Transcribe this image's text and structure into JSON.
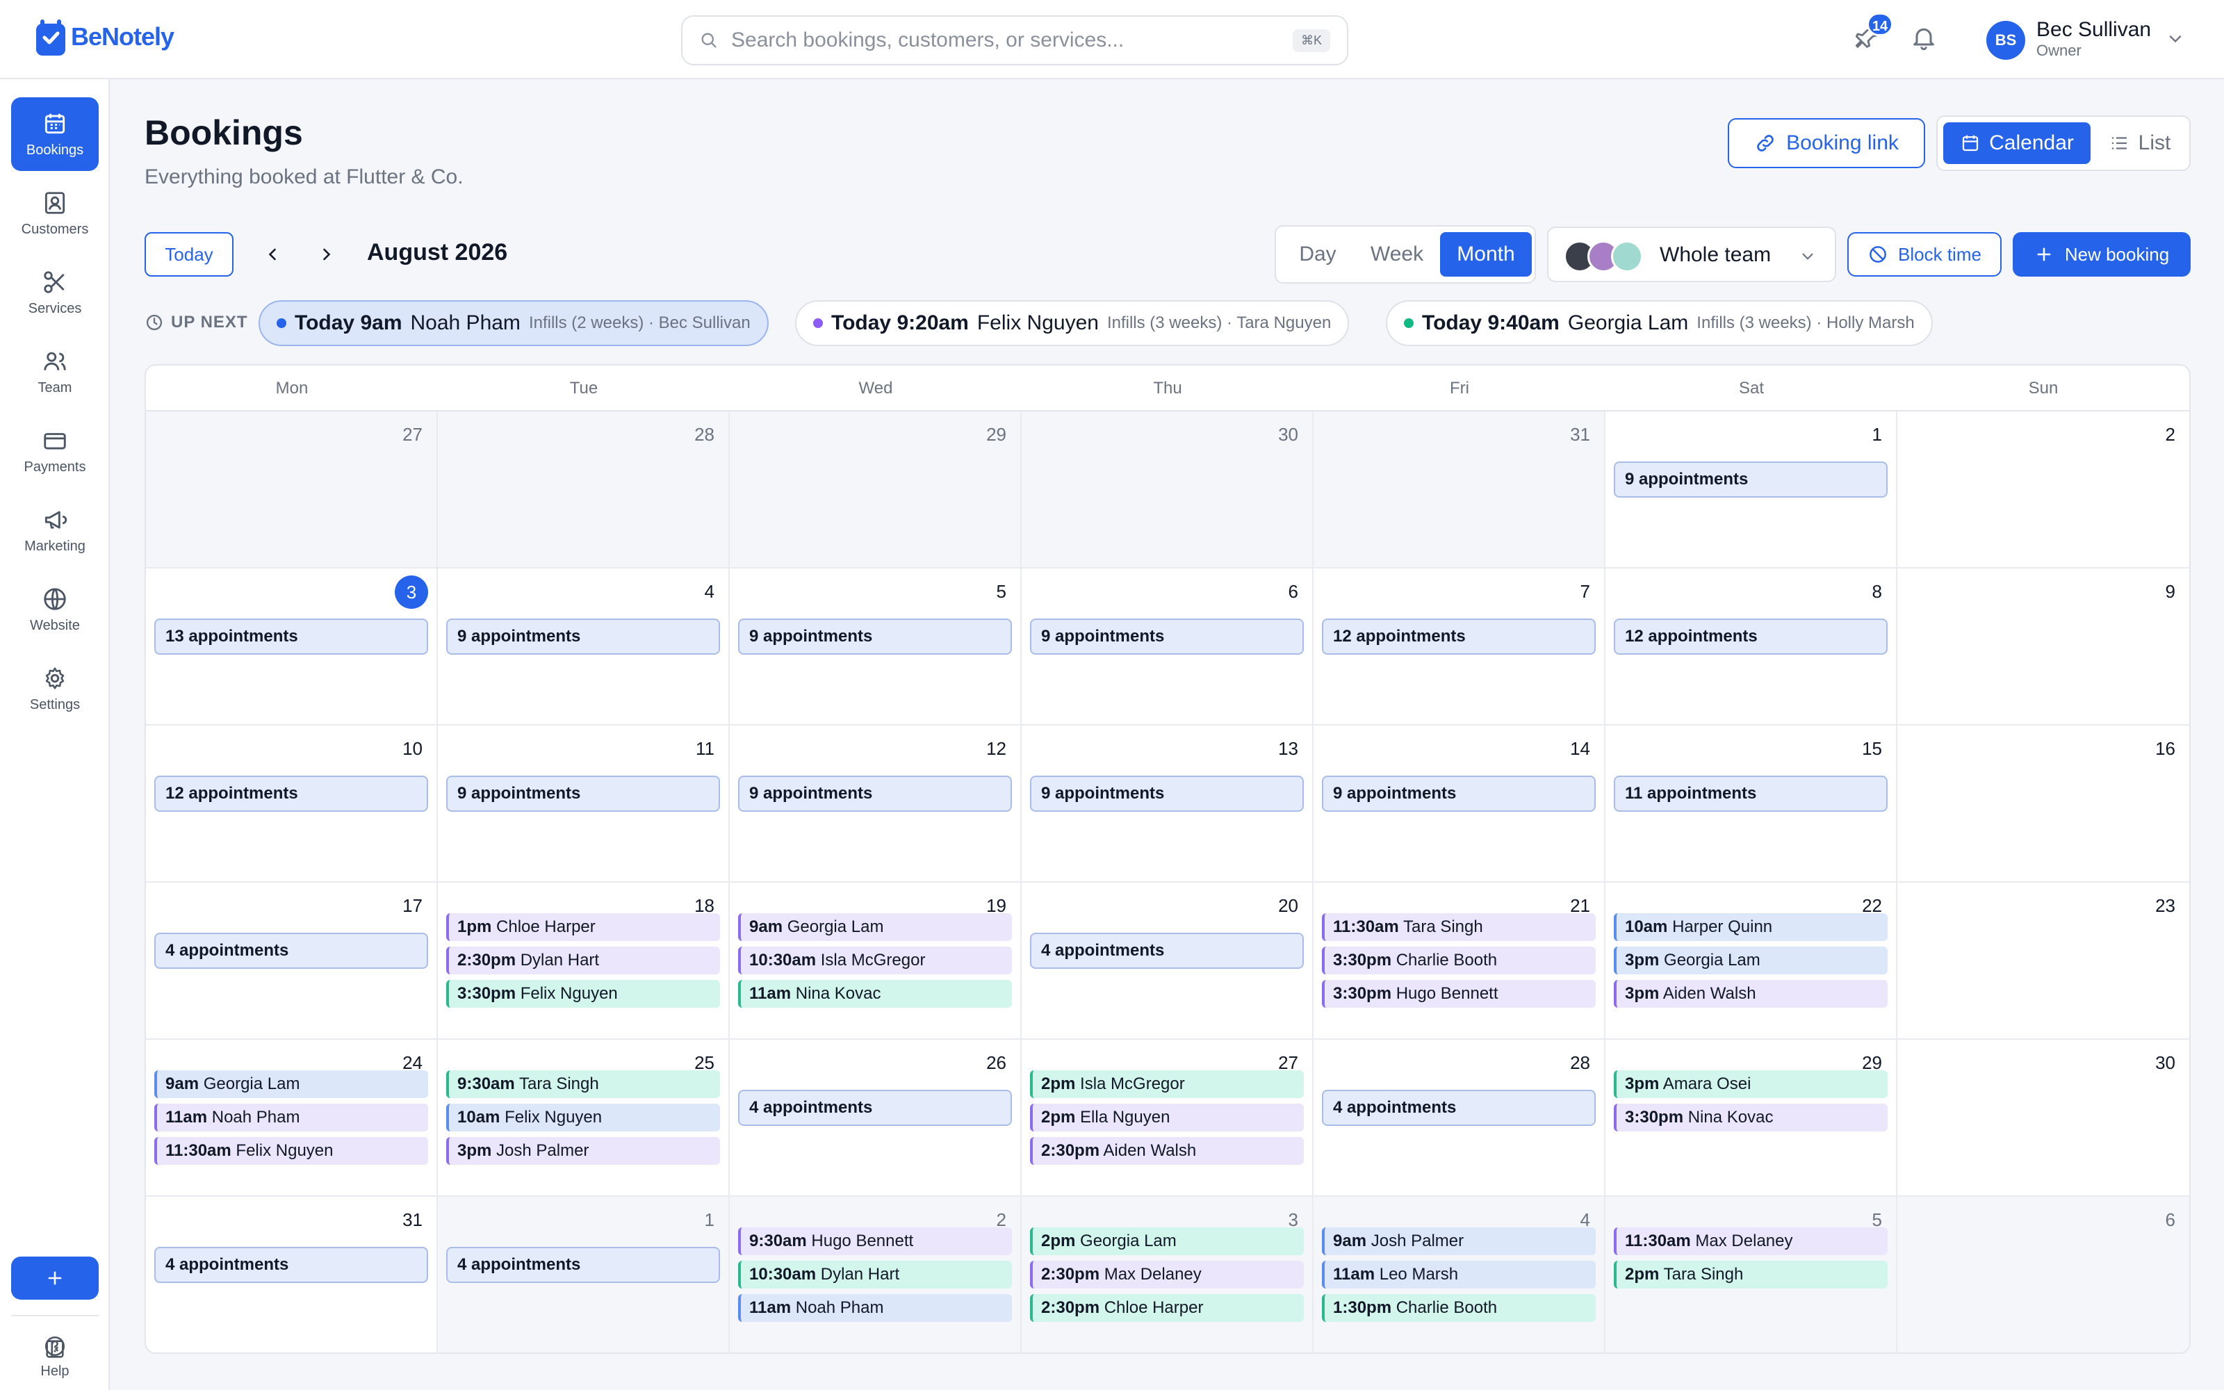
{
  "app": {
    "brand": "BeNotely"
  },
  "search": {
    "placeholder": "Search bookings, customers, or services...",
    "shortcut": "⌘K"
  },
  "header": {
    "notification_count": "14"
  },
  "user": {
    "initials": "BS",
    "name": "Bec Sullivan",
    "role": "Owner"
  },
  "sidebar": {
    "items": [
      {
        "label": "Bookings",
        "icon": "calendar-icon",
        "active": true
      },
      {
        "label": "Customers",
        "icon": "user-card-icon"
      },
      {
        "label": "Services",
        "icon": "scissors-icon"
      },
      {
        "label": "Team",
        "icon": "team-icon"
      },
      {
        "label": "Payments",
        "icon": "credit-card-icon"
      },
      {
        "label": "Marketing",
        "icon": "megaphone-icon"
      },
      {
        "label": "Website",
        "icon": "globe-icon"
      },
      {
        "label": "Settings",
        "icon": "gear-icon"
      }
    ],
    "help_label": "Help"
  },
  "page": {
    "title": "Bookings",
    "subtitle": "Everything booked at Flutter & Co."
  },
  "actions": {
    "booking_link": "Booking link",
    "calendar": "Calendar",
    "list": "List",
    "block_time": "Block time",
    "new_booking": "New booking"
  },
  "nav": {
    "today": "Today",
    "month_label": "August 2026",
    "views": [
      "Day",
      "Week",
      "Month"
    ],
    "active_view": "Month",
    "team_filter": "Whole team"
  },
  "up_next": {
    "label": "UP NEXT",
    "items": [
      {
        "time": "Today 9am",
        "name": "Noah Pham",
        "meta": "Infills (2 weeks) · Bec Sullivan",
        "dot": "#2563eb"
      },
      {
        "time": "Today 9:20am",
        "name": "Felix Nguyen",
        "meta": "Infills (3 weeks) · Tara Nguyen",
        "dot": "#8b5cf6"
      },
      {
        "time": "Today 9:40am",
        "name": "Georgia Lam",
        "meta": "Infills (3 weeks) · Holly Marsh",
        "dot": "#10b981"
      }
    ]
  },
  "calendar": {
    "weekdays": [
      "Mon",
      "Tue",
      "Wed",
      "Thu",
      "Fri",
      "Sat",
      "Sun"
    ],
    "weeks": [
      [
        {
          "day": "27",
          "out": true
        },
        {
          "day": "28",
          "out": true
        },
        {
          "day": "29",
          "out": true
        },
        {
          "day": "30",
          "out": true
        },
        {
          "day": "31",
          "out": true
        },
        {
          "day": "1",
          "summary": "9 appointments"
        },
        {
          "day": "2"
        }
      ],
      [
        {
          "day": "3",
          "today": true,
          "summary": "13 appointments"
        },
        {
          "day": "4",
          "summary": "9 appointments"
        },
        {
          "day": "5",
          "summary": "9 appointments"
        },
        {
          "day": "6",
          "summary": "9 appointments"
        },
        {
          "day": "7",
          "summary": "12 appointments"
        },
        {
          "day": "8",
          "summary": "12 appointments"
        },
        {
          "day": "9"
        }
      ],
      [
        {
          "day": "10",
          "summary": "12 appointments"
        },
        {
          "day": "11",
          "summary": "9 appointments"
        },
        {
          "day": "12",
          "summary": "9 appointments"
        },
        {
          "day": "13",
          "summary": "9 appointments"
        },
        {
          "day": "14",
          "summary": "9 appointments"
        },
        {
          "day": "15",
          "summary": "11 appointments"
        },
        {
          "day": "16"
        }
      ],
      [
        {
          "day": "17",
          "summary": "4 appointments"
        },
        {
          "day": "18",
          "appts": [
            {
              "time": "1pm",
              "name": "Chloe Harper",
              "color": "purple"
            },
            {
              "time": "2:30pm",
              "name": "Dylan Hart",
              "color": "purple"
            },
            {
              "time": "3:30pm",
              "name": "Felix Nguyen",
              "color": "green"
            }
          ]
        },
        {
          "day": "19",
          "appts": [
            {
              "time": "9am",
              "name": "Georgia Lam",
              "color": "purple"
            },
            {
              "time": "10:30am",
              "name": "Isla McGregor",
              "color": "purple"
            },
            {
              "time": "11am",
              "name": "Nina Kovac",
              "color": "green"
            }
          ]
        },
        {
          "day": "20",
          "summary": "4 appointments"
        },
        {
          "day": "21",
          "appts": [
            {
              "time": "11:30am",
              "name": "Tara Singh",
              "color": "purple"
            },
            {
              "time": "3:30pm",
              "name": "Charlie Booth",
              "color": "purple"
            },
            {
              "time": "3:30pm",
              "name": "Hugo Bennett",
              "color": "purple"
            }
          ]
        },
        {
          "day": "22",
          "appts": [
            {
              "time": "10am",
              "name": "Harper Quinn",
              "color": "blue"
            },
            {
              "time": "3pm",
              "name": "Georgia Lam",
              "color": "blue"
            },
            {
              "time": "3pm",
              "name": "Aiden Walsh",
              "color": "purple"
            }
          ]
        },
        {
          "day": "23"
        }
      ],
      [
        {
          "day": "24",
          "appts": [
            {
              "time": "9am",
              "name": "Georgia Lam",
              "color": "blue"
            },
            {
              "time": "11am",
              "name": "Noah Pham",
              "color": "purple"
            },
            {
              "time": "11:30am",
              "name": "Felix Nguyen",
              "color": "purple"
            }
          ]
        },
        {
          "day": "25",
          "appts": [
            {
              "time": "9:30am",
              "name": "Tara Singh",
              "color": "green"
            },
            {
              "time": "10am",
              "name": "Felix Nguyen",
              "color": "blue"
            },
            {
              "time": "3pm",
              "name": "Josh Palmer",
              "color": "purple"
            }
          ]
        },
        {
          "day": "26",
          "summary": "4 appointments"
        },
        {
          "day": "27",
          "appts": [
            {
              "time": "2pm",
              "name": "Isla McGregor",
              "color": "green"
            },
            {
              "time": "2pm",
              "name": "Ella Nguyen",
              "color": "purple"
            },
            {
              "time": "2:30pm",
              "name": "Aiden Walsh",
              "color": "purple"
            }
          ]
        },
        {
          "day": "28",
          "summary": "4 appointments"
        },
        {
          "day": "29",
          "appts": [
            {
              "time": "3pm",
              "name": "Amara Osei",
              "color": "green"
            },
            {
              "time": "3:30pm",
              "name": "Nina Kovac",
              "color": "purple"
            }
          ]
        },
        {
          "day": "30"
        }
      ],
      [
        {
          "day": "31",
          "summary": "4 appointments"
        },
        {
          "day": "1",
          "out": true,
          "summary": "4 appointments"
        },
        {
          "day": "2",
          "out": true,
          "appts": [
            {
              "time": "9:30am",
              "name": "Hugo Bennett",
              "color": "purple"
            },
            {
              "time": "10:30am",
              "name": "Dylan Hart",
              "color": "green"
            },
            {
              "time": "11am",
              "name": "Noah Pham",
              "color": "blue"
            }
          ]
        },
        {
          "day": "3",
          "out": true,
          "appts": [
            {
              "time": "2pm",
              "name": "Georgia Lam",
              "color": "green"
            },
            {
              "time": "2:30pm",
              "name": "Max Delaney",
              "color": "purple"
            },
            {
              "time": "2:30pm",
              "name": "Chloe Harper",
              "color": "green"
            }
          ]
        },
        {
          "day": "4",
          "out": true,
          "appts": [
            {
              "time": "9am",
              "name": "Josh Palmer",
              "color": "blue"
            },
            {
              "time": "11am",
              "name": "Leo Marsh",
              "color": "blue"
            },
            {
              "time": "1:30pm",
              "name": "Charlie Booth",
              "color": "green"
            }
          ]
        },
        {
          "day": "5",
          "out": true,
          "appts": [
            {
              "time": "11:30am",
              "name": "Max Delaney",
              "color": "purple"
            },
            {
              "time": "2pm",
              "name": "Tara Singh",
              "color": "green"
            }
          ]
        },
        {
          "day": "6",
          "out": true
        }
      ]
    ]
  }
}
